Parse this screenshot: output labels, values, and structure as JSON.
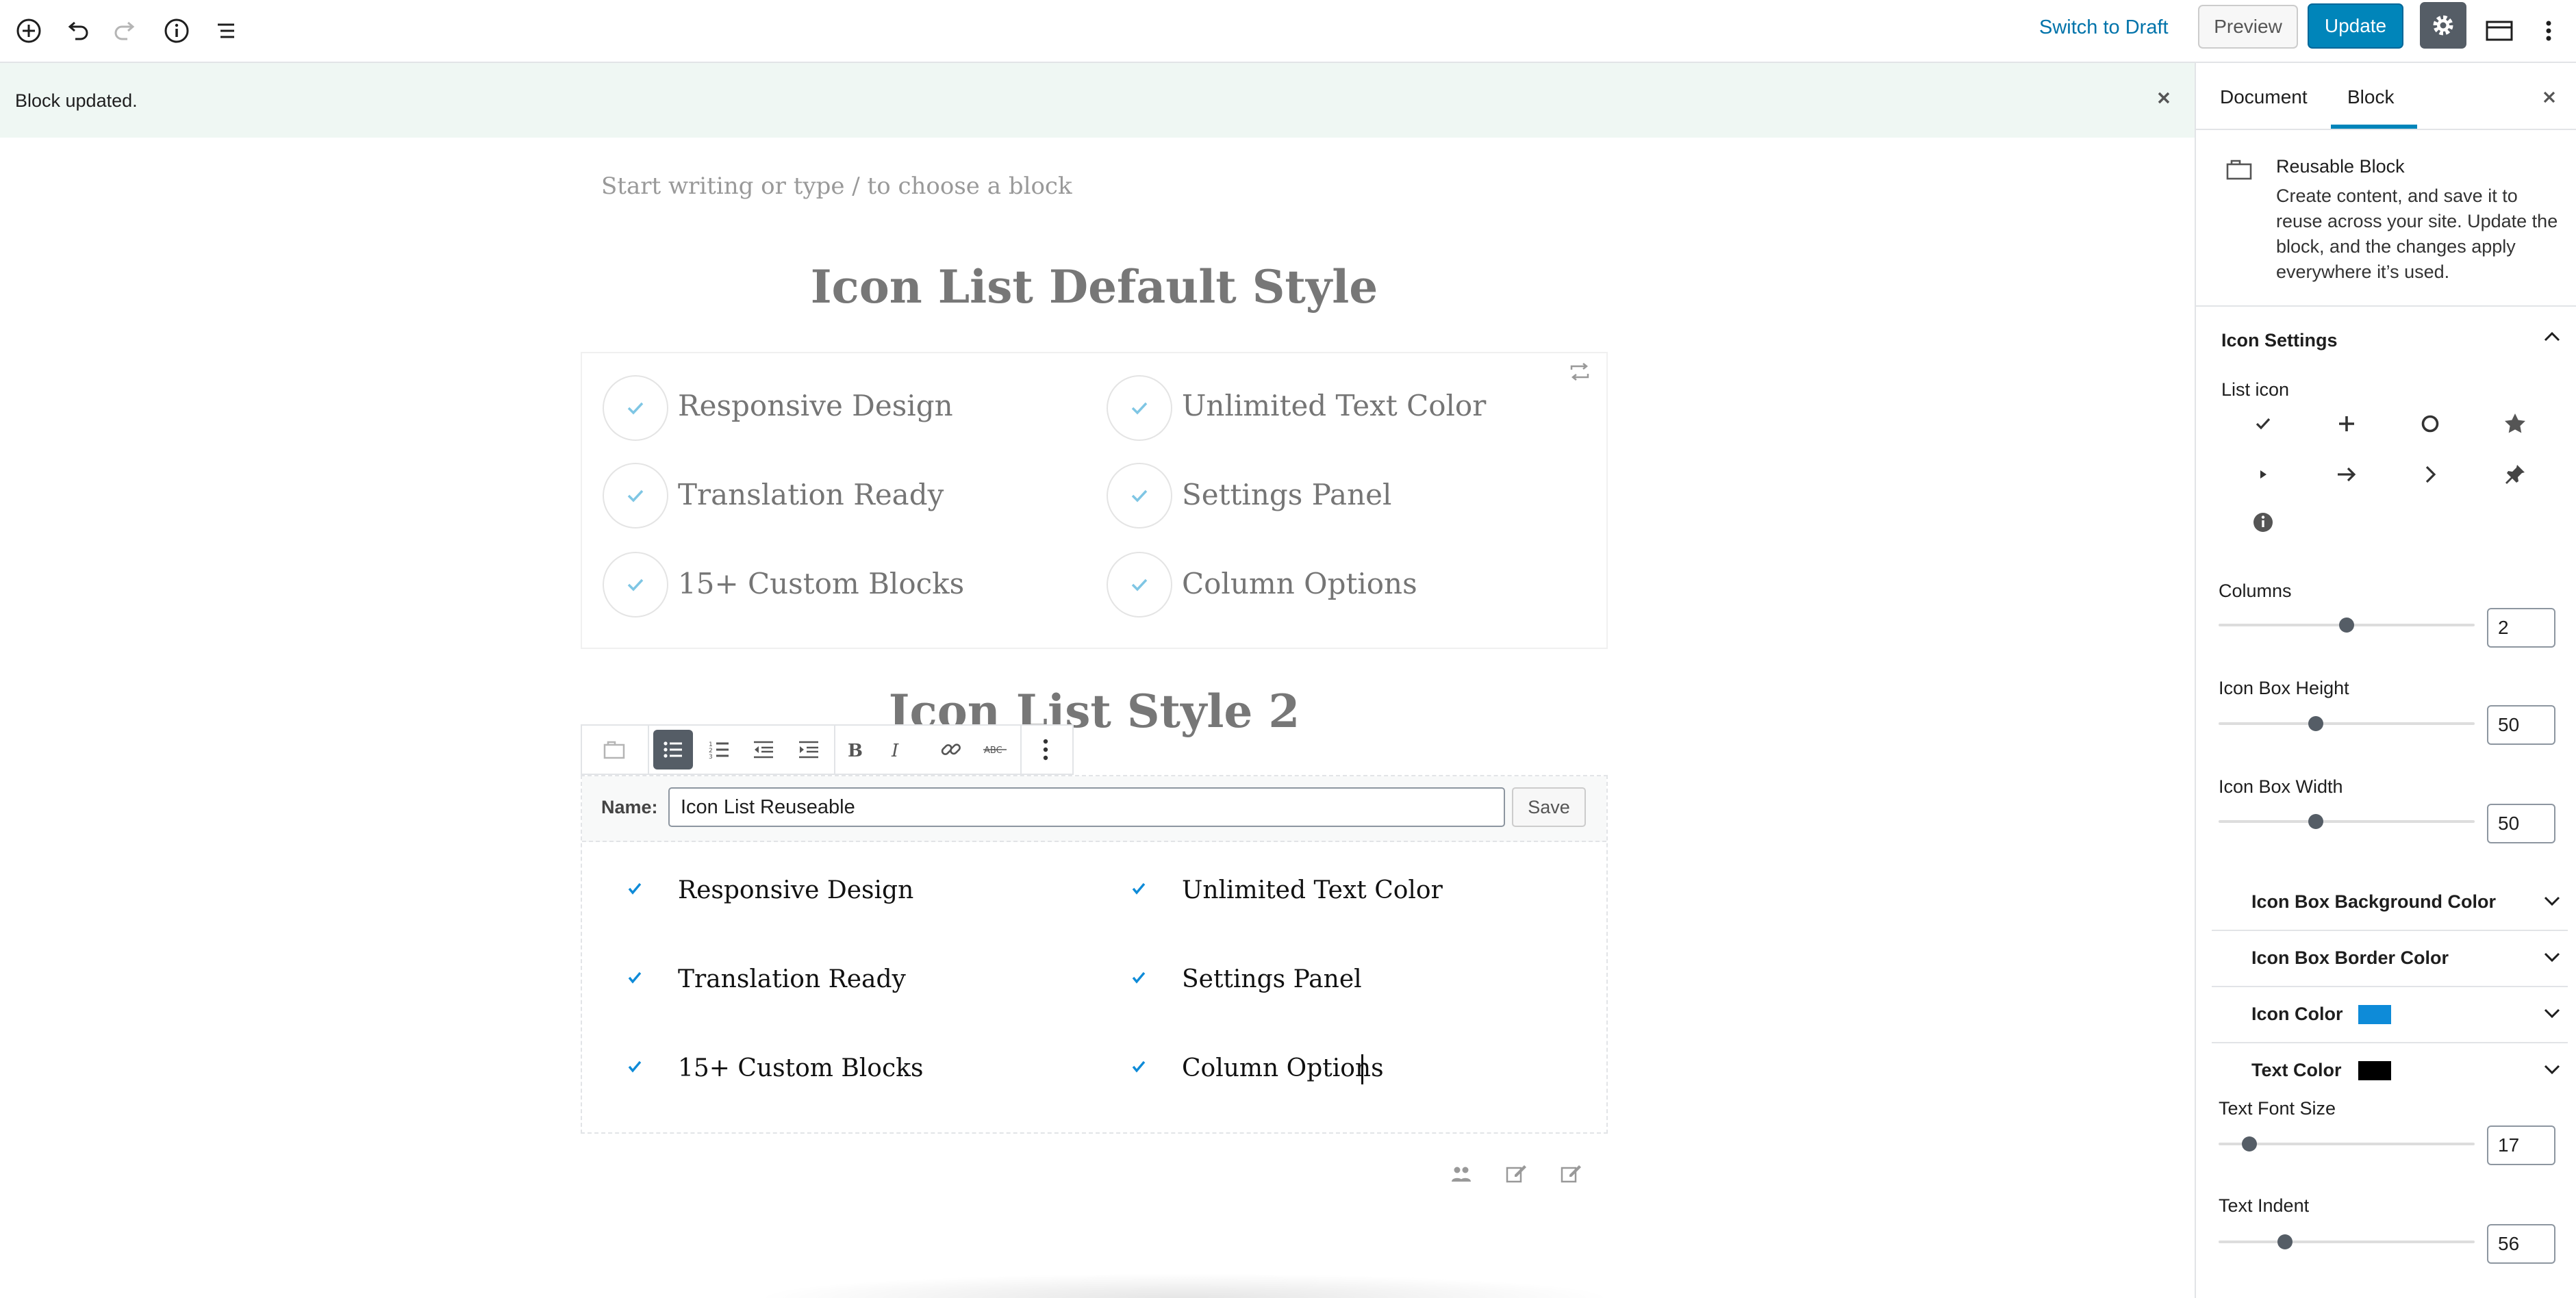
{
  "toolbar": {
    "switch_to_draft": "Switch to Draft",
    "preview": "Preview",
    "update": "Update"
  },
  "notice": {
    "text": "Block updated."
  },
  "editor": {
    "placeholder": "Start writing or type / to choose a block",
    "heading1": "Icon List Default Style",
    "list1": {
      "left": [
        "Responsive Design",
        "Translation Ready",
        "15+ Custom Blocks"
      ],
      "right": [
        "Unlimited Text Color",
        "Settings Panel",
        "Column Options"
      ]
    },
    "heading2": "Icon List Style 2",
    "reusable": {
      "name_label": "Name:",
      "name_value": "Icon List Reuseable",
      "save_label": "Save"
    },
    "list2": {
      "left": [
        "Responsive Design",
        "Translation Ready",
        "15+ Custom Blocks"
      ],
      "right": [
        "Unlimited Text Color",
        "Settings Panel",
        "Column Options"
      ]
    },
    "formatting_tools": [
      "reusable-block-icon",
      "unordered-list-icon",
      "ordered-list-icon",
      "outdent-icon",
      "indent-icon",
      "bold-icon",
      "italic-icon",
      "link-icon",
      "strikethrough-icon",
      "more-options-icon"
    ]
  },
  "sidebar": {
    "tabs": [
      "Document",
      "Block"
    ],
    "active_tab": "Block",
    "block_card": {
      "title": "Reusable Block",
      "description": "Create content, and save it to reuse across your site. Update the block, and the changes apply everywhere it’s used."
    },
    "icon_settings": {
      "title": "Icon Settings",
      "list_icon_label": "List icon",
      "icons": [
        "check-icon",
        "plus-icon",
        "circle-icon",
        "star-icon",
        "triangle-right-icon",
        "arrow-right-icon",
        "chevron-right-icon",
        "pin-icon",
        "info-icon"
      ],
      "selected_icon": "check-icon",
      "columns": {
        "label": "Columns",
        "value": "2",
        "level": 0.5
      },
      "icon_box_height": {
        "label": "Icon Box Height",
        "value": "50",
        "level": 0.38
      },
      "icon_box_width": {
        "label": "Icon Box Width",
        "value": "50",
        "level": 0.38
      }
    },
    "color_panels": {
      "icon_box_background": "Icon Box Background Color",
      "icon_box_border": "Icon Box Border Color",
      "icon_color": {
        "label": "Icon Color",
        "color": "#0e8bd8"
      },
      "text_color": {
        "label": "Text Color",
        "color": "#000000"
      }
    },
    "text_font_size": {
      "label": "Text Font Size",
      "value": "17",
      "level": 0.12
    },
    "text_indent": {
      "label": "Text Indent",
      "value": "56",
      "level": 0.26
    }
  },
  "colors": {
    "accent": "#0085ba",
    "check": "#5bbfe3",
    "notice_bg": "#eff7f3"
  }
}
